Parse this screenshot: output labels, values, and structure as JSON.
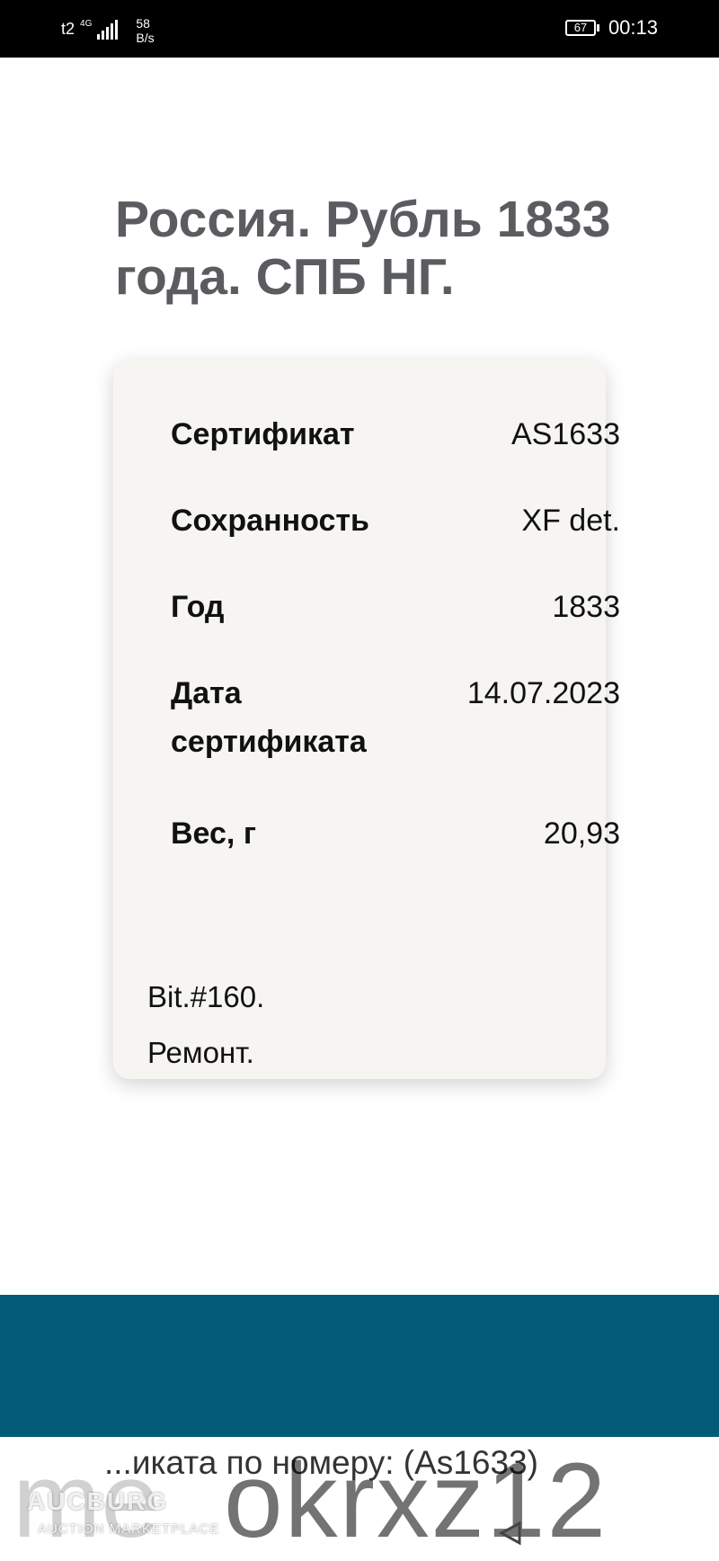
{
  "status_bar": {
    "carrier": "t2",
    "network_type": "4G",
    "data_speed_value": "58",
    "data_speed_unit": "B/s",
    "battery": "67",
    "time": "00:13",
    "icons": [
      "signal-bars-icon",
      "battery-icon"
    ]
  },
  "page": {
    "title": "Россия. Рубль 1833 года. СПБ НГ."
  },
  "certificate": {
    "rows": [
      {
        "label": "Сертификат",
        "value": "AS1633"
      },
      {
        "label": "Сохранность",
        "value": "XF det."
      },
      {
        "label": "Год",
        "value": "1833"
      },
      {
        "label": "Дата сертификата",
        "value": "14.07.2023"
      },
      {
        "label": "Вес, г",
        "value": "20,93"
      }
    ],
    "notes": [
      "Bit.#160.",
      "Ремонт."
    ]
  },
  "footer": {
    "band_color": "#005a78",
    "search_text": "...иката по номеру: (As1633)"
  },
  "watermark": {
    "brand": "AUCBURG",
    "tagline": "AUCTION MARKETPLACE",
    "left_text": "me",
    "id_text": "okrxz12"
  }
}
